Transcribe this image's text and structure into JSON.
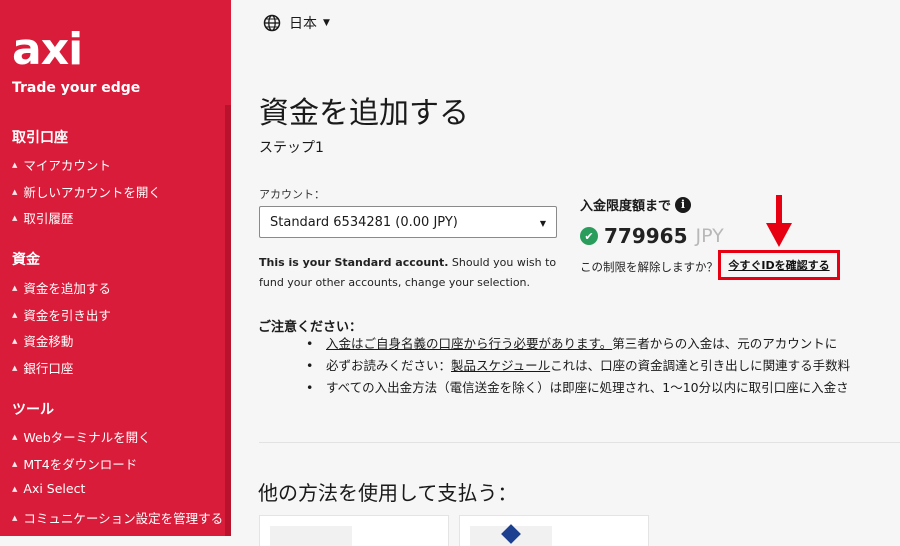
{
  "brand": {
    "logo_text": "axi",
    "tagline": "Trade your edge"
  },
  "sidebar": {
    "sections": [
      {
        "heading": "取引口座",
        "items": [
          "マイアカウント",
          "新しいアカウントを開く",
          "取引履歴"
        ]
      },
      {
        "heading": "資金",
        "items": [
          "資金を追加する",
          "資金を引き出す",
          "資金移動",
          "銀行口座"
        ]
      },
      {
        "heading": "ツール",
        "items": [
          "Webターミナルを開く",
          "MT4をダウンロード",
          "Axi Select",
          "コミュニケーション設定を管理する"
        ]
      }
    ]
  },
  "language": {
    "label": "日本",
    "icon": "globe-icon"
  },
  "page": {
    "title": "資金を追加する",
    "step": "ステップ1"
  },
  "account": {
    "label": "アカウント：",
    "selected": "Standard 6534281 (0.00 JPY)",
    "note_bold": "This is your Standard account.",
    "note_rest": " Should you wish to fund your other accounts, change your selection."
  },
  "limit": {
    "title": "入金限度額まで",
    "info_symbol": "i",
    "amount": "779965",
    "currency": "JPY",
    "question": "この制限を解除しますか？",
    "verify_link": "今すぐIDを確認する",
    "highlight_color": "#e60012"
  },
  "notice": {
    "title": "ご注意ください：",
    "items": [
      {
        "link": "入金はご自身名義の口座から行う必要があります。",
        "text": " 第三者からの入金は、元のアカウントに"
      },
      {
        "prefix": "必ずお読みください：",
        "link": "製品スケジュール",
        "text": " これは、口座の資金調達と引き出しに関連する手数料"
      },
      {
        "text": "すべての入出金方法（電信送金を除く）は即座に処理され、1〜10分以内に取引口座に入金さ"
      }
    ]
  },
  "other_methods": {
    "title": "他の方法を使用して支払う："
  },
  "colors": {
    "sidebar": "#d91c3a",
    "check": "#2a9d5c"
  }
}
